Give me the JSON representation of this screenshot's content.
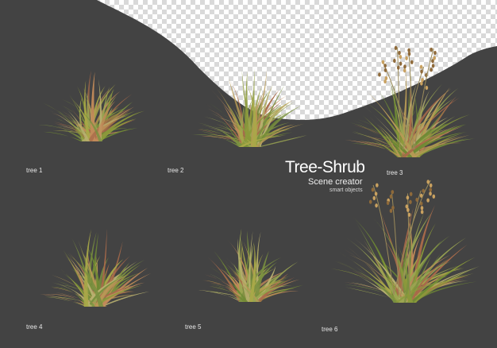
{
  "title": "Tree-Shrub",
  "subtitle": "Scene creator",
  "tagline": "smart objects",
  "labels": [
    "tree 1",
    "tree 2",
    "tree 3",
    "tree 4",
    "tree 5",
    "tree 6"
  ],
  "colors": {
    "background": "#434343",
    "checker_light": "#ffffff",
    "checker_dark": "#d9d9d9",
    "text": "#ffffff"
  }
}
